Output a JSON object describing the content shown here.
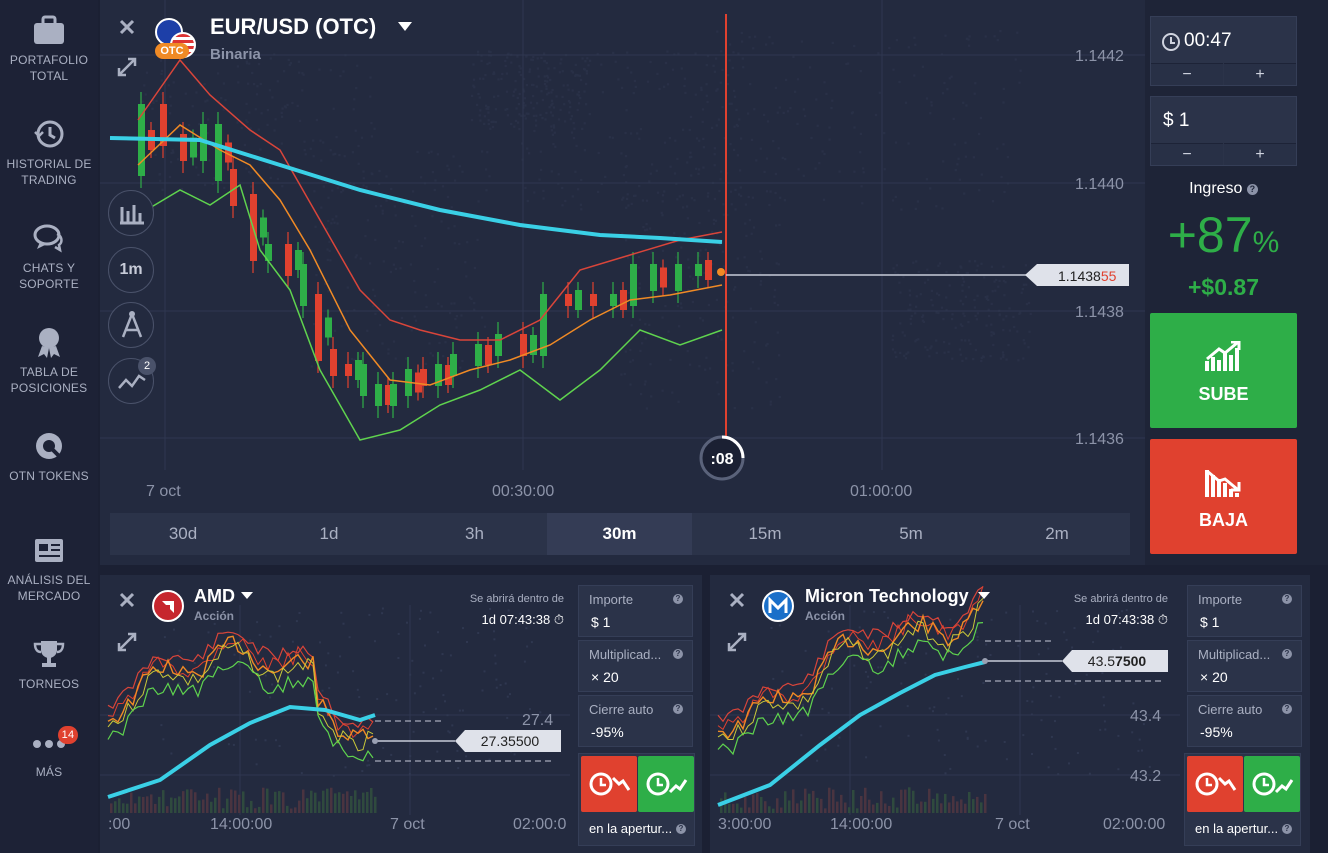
{
  "sidebar": {
    "items": [
      {
        "label": "PORTAFOLIO TOTAL",
        "icon": "briefcase-icon"
      },
      {
        "label": "HISTORIAL DE TRADING",
        "icon": "history-icon"
      },
      {
        "label": "CHATS Y SOPORTE",
        "icon": "chat-icon"
      },
      {
        "label": "TABLA DE POSICIONES",
        "icon": "medal-icon"
      },
      {
        "label": "OTN TOKENS",
        "icon": "token-icon"
      },
      {
        "label": "ANÁLISIS DEL MERCADO",
        "icon": "news-icon"
      },
      {
        "label": "TORNEOS",
        "icon": "trophy-icon"
      },
      {
        "label": "MÁS",
        "icon": "more-icon",
        "badge": "14"
      }
    ]
  },
  "main_chart": {
    "asset": "EUR/USD (OTC)",
    "type": "Binaria",
    "otc_badge": "OTC",
    "price_levels": [
      "1.1442",
      "1.1440",
      "1.1438",
      "1.1436"
    ],
    "current_price_main": "1.1438",
    "current_price_tail": "55",
    "time_labels": [
      "7 oct",
      "00:30:00",
      "01:00:00"
    ],
    "countdown": ":08",
    "timeframe_button": "1m",
    "indicator_count": "2",
    "timeframes": [
      "30d",
      "1d",
      "3h",
      "30m",
      "15m",
      "5m",
      "2m"
    ],
    "active_timeframe": "30m"
  },
  "trade_panel": {
    "time": "00:47",
    "amount": "$ 1",
    "minus": "−",
    "plus": "+",
    "income_label": "Ingreso",
    "income_percent": "+87",
    "percent_sign": "%",
    "income_value": "+$0.87",
    "up_label": "SUBE",
    "down_label": "BAJA"
  },
  "mini_charts": [
    {
      "asset": "AMD",
      "type": "Acción",
      "opens_label": "Se abrirá dentro de",
      "opens_value": "1d 07:43:38",
      "price": "27.35500",
      "levels": [
        "27.4"
      ],
      "time_labels": [
        ":00",
        "14:00:00",
        "7 oct",
        "02:00:0"
      ],
      "importe_label": "Importe",
      "importe_value": "$ 1",
      "mult_label": "Multiplicad...",
      "mult_value": "× 20",
      "auto_label": "Cierre auto",
      "auto_value": "-95%",
      "open_label": "en la apertur..."
    },
    {
      "asset": "Micron Technology",
      "type": "Acción",
      "opens_label": "Se abrirá dentro de",
      "opens_value": "1d 07:43:38",
      "price_main": "43.5",
      "price_tail": "7500",
      "levels": [
        "43.4",
        "43.2"
      ],
      "time_labels": [
        "3:00:00",
        "14:00:00",
        "7 oct",
        "02:00:00"
      ],
      "importe_label": "Importe",
      "importe_value": "$ 1",
      "mult_label": "Multiplicad...",
      "mult_value": "× 20",
      "auto_label": "Cierre auto",
      "auto_value": "-95%",
      "open_label": "en la apertur..."
    }
  ],
  "colors": {
    "up": "#2eae48",
    "down": "#e0412f",
    "ma": "#3ad0e6",
    "upper": "#d9453a",
    "lower": "#5fd34e",
    "mid": "#f08a25"
  }
}
